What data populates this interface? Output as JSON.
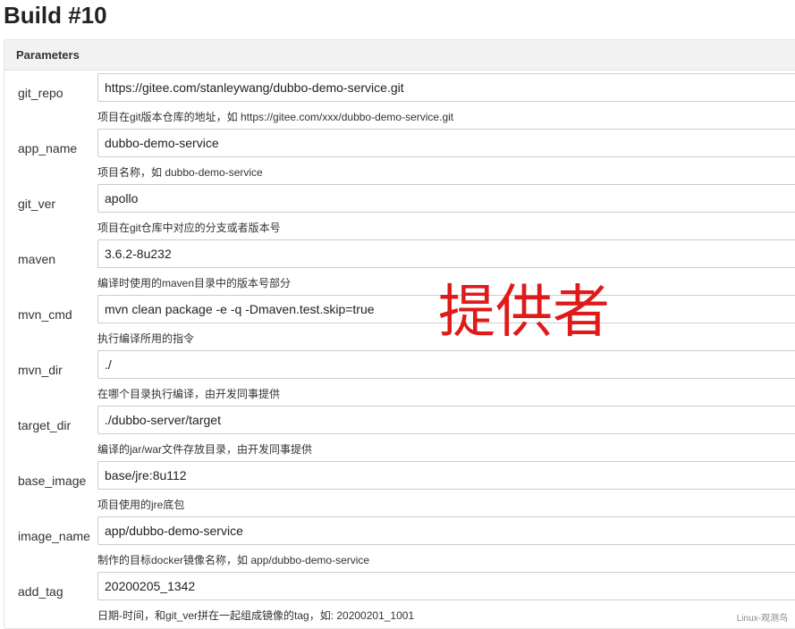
{
  "page": {
    "title": "Build #10"
  },
  "panel": {
    "header": "Parameters"
  },
  "params": [
    {
      "name": "git_repo",
      "value": "https://gitee.com/stanleywang/dubbo-demo-service.git",
      "desc": "项目在git版本仓库的地址，如 https://gitee.com/xxx/dubbo-demo-service.git"
    },
    {
      "name": "app_name",
      "value": "dubbo-demo-service",
      "desc": "项目名称，如 dubbo-demo-service"
    },
    {
      "name": "git_ver",
      "value": "apollo",
      "desc": "项目在git仓库中对应的分支或者版本号"
    },
    {
      "name": "maven",
      "value": "3.6.2-8u232",
      "desc": "编译时使用的maven目录中的版本号部分"
    },
    {
      "name": "mvn_cmd",
      "value": "mvn clean package -e -q -Dmaven.test.skip=true",
      "desc": "执行编译所用的指令"
    },
    {
      "name": "mvn_dir",
      "value": "./",
      "desc": "在哪个目录执行编译，由开发同事提供"
    },
    {
      "name": "target_dir",
      "value": "./dubbo-server/target",
      "desc": "编译的jar/war文件存放目录，由开发同事提供"
    },
    {
      "name": "base_image",
      "value": "base/jre:8u112",
      "desc": "项目使用的jre底包"
    },
    {
      "name": "image_name",
      "value": "app/dubbo-demo-service",
      "desc": "制作的目标docker镜像名称，如 app/dubbo-demo-service"
    },
    {
      "name": "add_tag",
      "value": "20200205_1342",
      "desc": "日期-时间，和git_ver拼在一起组成镜像的tag，如: 20200201_1001"
    }
  ],
  "watermark": {
    "text": "提供者",
    "color": "#e01a1a"
  },
  "corner_mark": {
    "text": "Linux-观测鸟"
  }
}
